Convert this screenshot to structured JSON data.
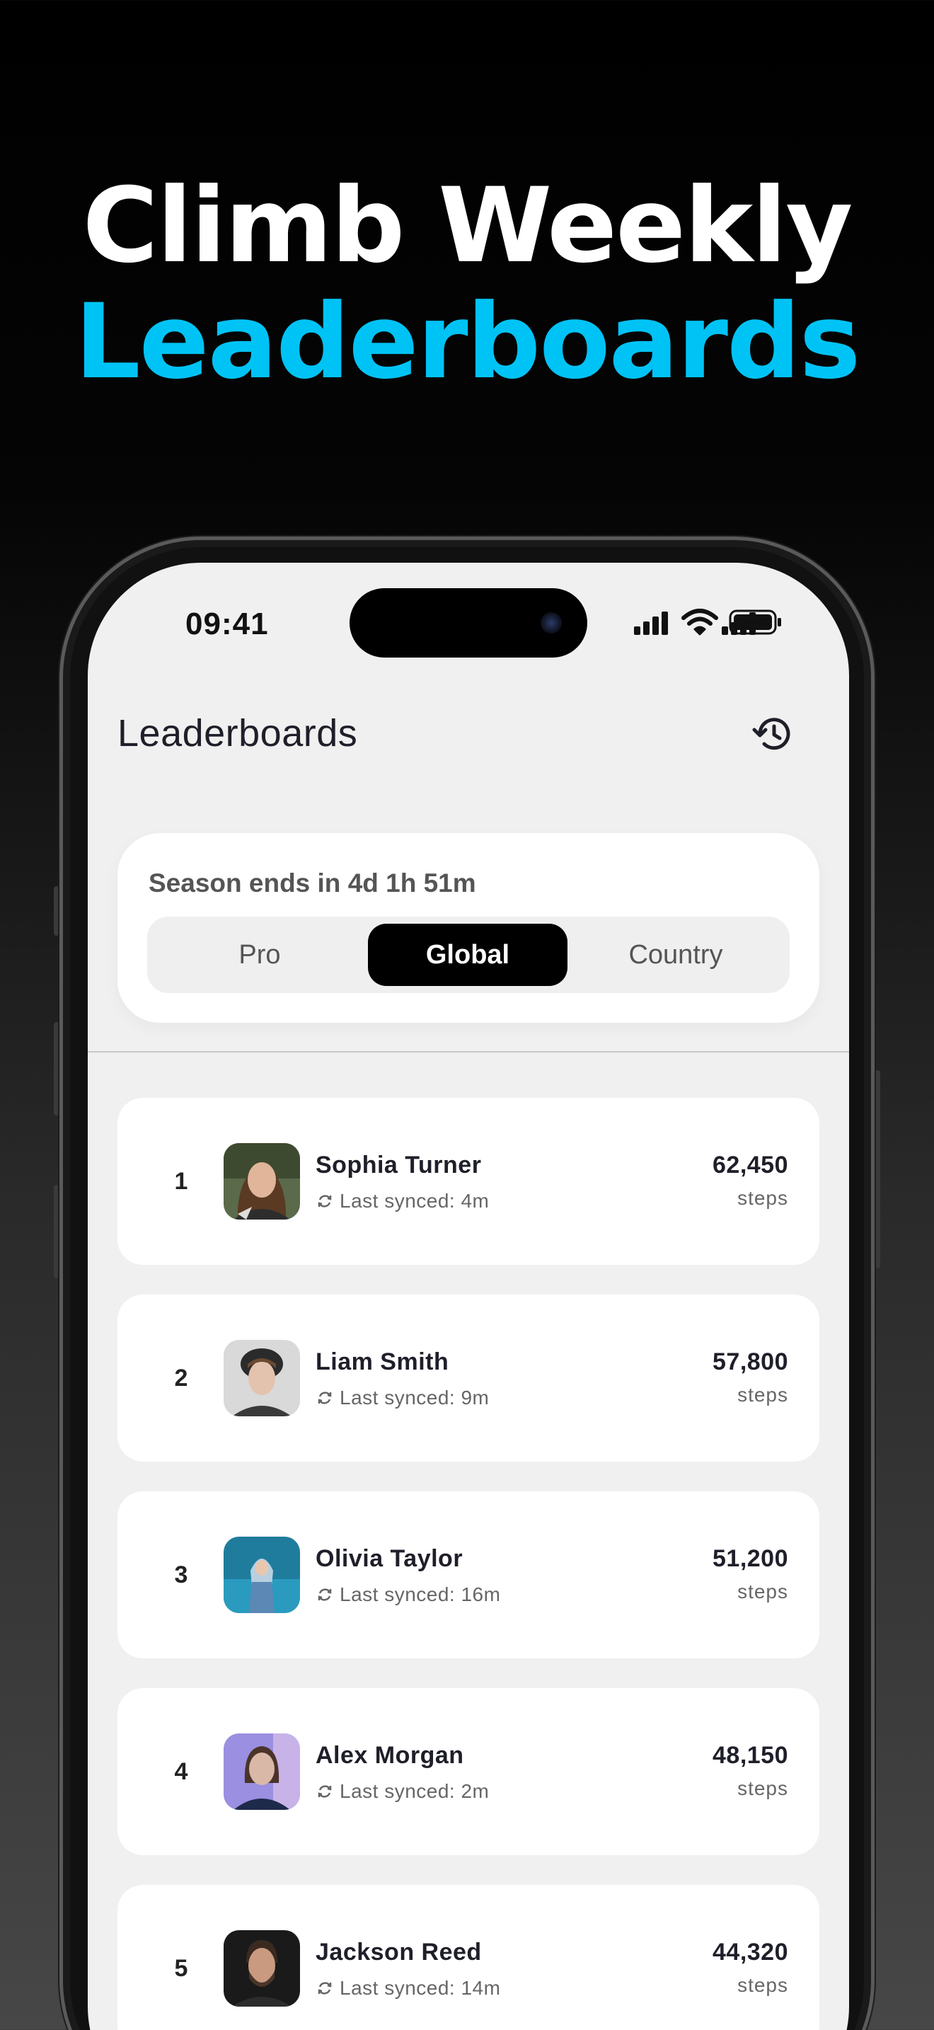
{
  "headline": {
    "line1": "Climb Weekly",
    "line2": "Leaderboards",
    "line2_color": "#00c3f5"
  },
  "status_bar": {
    "time": "09:41",
    "icons": [
      "cellular-signal-icon",
      "wifi-icon",
      "battery-icon"
    ]
  },
  "header": {
    "title": "Leaderboards",
    "history_icon": "history-icon"
  },
  "season": {
    "text": "Season ends in 4d 1h 51m",
    "tabs": [
      {
        "label": "Pro",
        "selected": false
      },
      {
        "label": "Global",
        "selected": true
      },
      {
        "label": "Country",
        "selected": false
      }
    ]
  },
  "leaderboard": {
    "rows": [
      {
        "rank": "1",
        "name": "Sophia Turner",
        "sync": "Last synced: 4m",
        "steps": "62,450",
        "unit": "steps"
      },
      {
        "rank": "2",
        "name": "Liam Smith",
        "sync": "Last synced: 9m",
        "steps": "57,800",
        "unit": "steps"
      },
      {
        "rank": "3",
        "name": "Olivia Taylor",
        "sync": "Last synced: 16m",
        "steps": "51,200",
        "unit": "steps"
      },
      {
        "rank": "4",
        "name": "Alex Morgan",
        "sync": "Last synced: 2m",
        "steps": "48,150",
        "unit": "steps"
      },
      {
        "rank": "5",
        "name": "Jackson Reed",
        "sync": "Last synced: 14m",
        "steps": "44,320",
        "unit": "steps"
      }
    ]
  }
}
